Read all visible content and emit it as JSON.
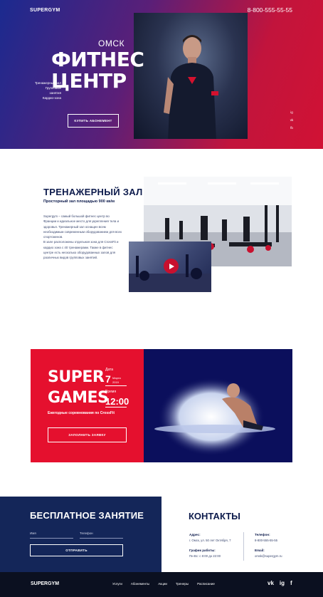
{
  "header": {
    "logo": "SUPERGYM",
    "phone": "8-800-555-55-55"
  },
  "hero": {
    "city": "ОМСК",
    "title_line1": "ФИТНЕС",
    "title_line2": "ЦЕНТР",
    "services": [
      "Тренажерный зал",
      "Групповые занятия",
      "Кардио-зона"
    ],
    "cta_label": "КУПИТЬ АБОНЕМЕНТ",
    "socials": [
      "ig",
      "vk",
      "fb"
    ]
  },
  "gym": {
    "title": "ТРЕНАЖЕРНЫЙ ЗАЛ",
    "subtitle": "Просторный зал площадью 900 кв/м",
    "paragraph1": "Supergym – самый большой фитнес центр во Франции и идеальное место для укрепления тела и здоровья. Тренажерный зал оснащен всем необходимым современным оборудованием для всех спортсменов.",
    "paragraph2": "В зале расположены отдельная зона для CrossFit и кардио зона с 40 тренажерами. Также в фитнес центре есть несколько оборудованных залов для различных видов групповых занятий."
  },
  "games": {
    "title_line1": "SUPER",
    "title_line2": "GAMES",
    "date_label": "Дата",
    "date_day": "7",
    "date_month": "Марта",
    "date_year": "2019",
    "time_label": "Время",
    "time_value": "12:00",
    "description": "Ежегодные соревнования по CrossFit",
    "cta_label": "ЗАПОЛНИТЬ ЗАЯВКУ"
  },
  "free_class": {
    "title": "БЕСПЛАТНОЕ ЗАНЯТИЕ",
    "name_placeholder": "Имя",
    "phone_placeholder": "Телефон",
    "submit_label": "ОТПРАВИТЬ"
  },
  "contacts": {
    "title": "КОНТАКТЫ",
    "address_label": "Адрес:",
    "address_value": "г. Омск, ул. 50 лет Октября, 7",
    "hours_label": "График работы:",
    "hours_value": "Пн-Вс: с 8:00 до 22:00",
    "phone_label": "Телефон:",
    "phone_value": "8-800-555-55-55",
    "email_label": "Email:",
    "email_value": "omsk@supergym.ru"
  },
  "footer": {
    "logo": "SUPERGYM",
    "nav": [
      "Услуги",
      "Абонементы",
      "Акции",
      "Тренеры",
      "Расписание"
    ],
    "icons": [
      "vk",
      "ig",
      "f"
    ]
  },
  "colors": {
    "brand_red": "#e5102e",
    "brand_navy": "#142659",
    "footer_bg": "#0b1020",
    "games_blue": "#0b0f5c"
  }
}
